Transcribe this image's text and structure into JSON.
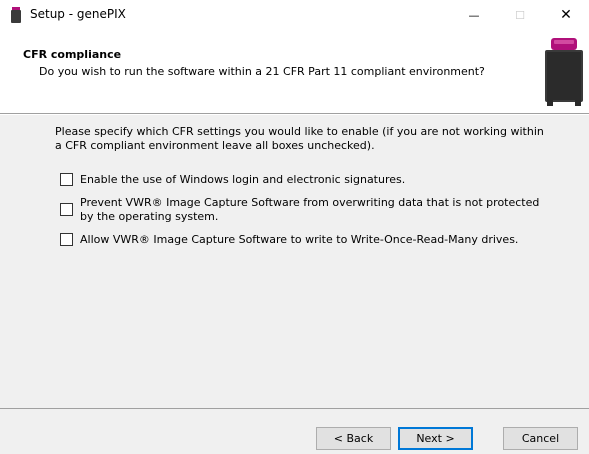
{
  "window": {
    "title": "Setup - genePIX",
    "minimize_glyph": "—",
    "maximize_glyph": "☐",
    "close_glyph": "✕"
  },
  "header": {
    "title": "CFR compliance",
    "description": "Do you wish to run the software within a 21 CFR Part 11 compliant environment?"
  },
  "content": {
    "intro": "Please specify which CFR settings you would like to enable (if you are not working within a CFR compliant environment leave all boxes unchecked).",
    "options": [
      {
        "label": "Enable the use of Windows login and electronic signatures.",
        "checked": false
      },
      {
        "label": "Prevent VWR® Image Capture Software from overwriting data that is not protected by the operating system.",
        "checked": false
      },
      {
        "label": "Allow VWR® Image Capture Software to write to Write-Once-Read-Many drives.",
        "checked": false
      }
    ]
  },
  "buttons": {
    "back": "< Back",
    "next": "Next >",
    "cancel": "Cancel"
  },
  "colors": {
    "accent_magenta": "#b0107a",
    "device_dark": "#3a3a3a",
    "default_button_border": "#0078d7"
  }
}
